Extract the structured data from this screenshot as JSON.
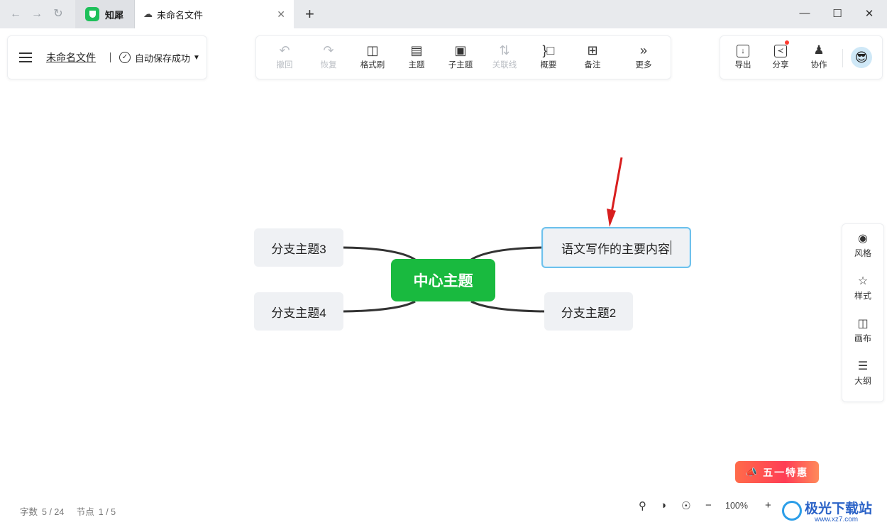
{
  "titlebar": {
    "app_tab_label": "知犀",
    "doc_tab_label": "未命名文件"
  },
  "header": {
    "doc_title": "未命名文件",
    "save_status": "自动保存成功"
  },
  "toolbar": {
    "undo": "撤回",
    "redo": "恢复",
    "format_brush": "格式刷",
    "topic": "主题",
    "subtopic": "子主题",
    "relation": "关联线",
    "summary": "概要",
    "note": "备注",
    "more": "更多"
  },
  "right_toolbar": {
    "export": "导出",
    "share": "分享",
    "collab": "协作"
  },
  "mindmap": {
    "center": "中心主题",
    "branch_top_left": "分支主题3",
    "branch_bottom_left": "分支主题4",
    "branch_top_right_editing": "语文写作的主要内容",
    "branch_bottom_right": "分支主题2"
  },
  "side_panel": {
    "style": "风格",
    "format": "样式",
    "canvas": "画布",
    "outline": "大纲"
  },
  "status_bar": {
    "word_count_label": "字数",
    "word_count_value": "5 / 24",
    "node_count_label": "节点",
    "node_count_value": "1 / 5",
    "zoom": "100%"
  },
  "promo": {
    "label": "五一特惠"
  },
  "watermark": {
    "text": "极光下载站",
    "sub": "www.xz7.com"
  },
  "colors": {
    "center_node": "#19ba3f",
    "selection_border": "#6ec1ec",
    "annotation_arrow": "#d81e1e"
  }
}
